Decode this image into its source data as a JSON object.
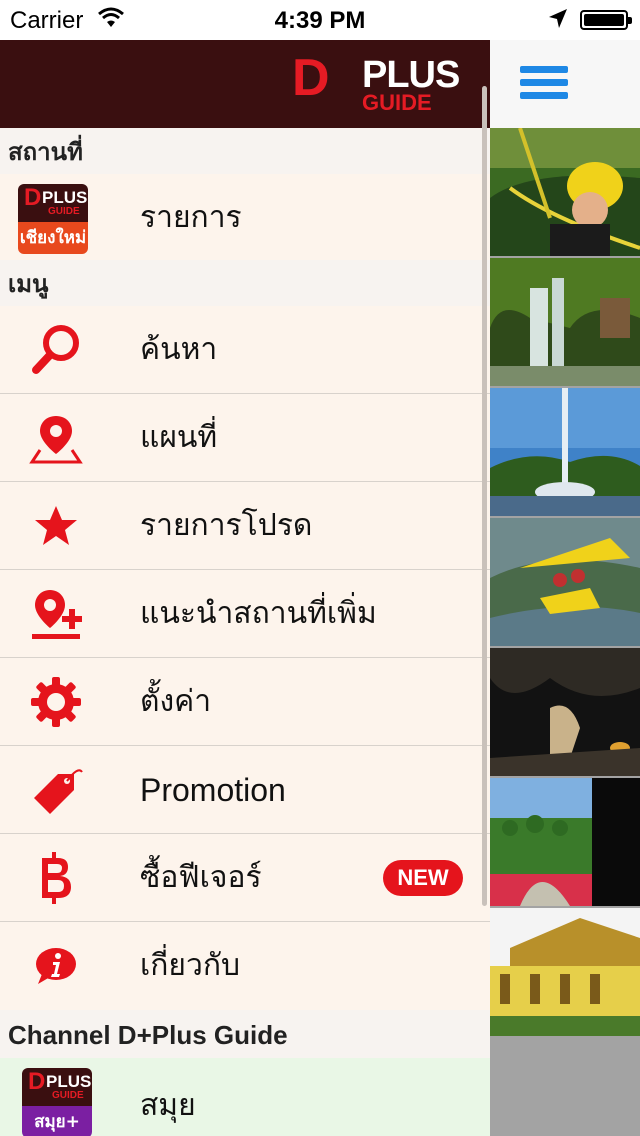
{
  "status_bar": {
    "carrier": "Carrier",
    "time": "4:39 PM"
  },
  "brand": {
    "logo_d": "D",
    "logo_plus": "PLUS",
    "logo_guide": "GUIDE",
    "accent": "#e51b24",
    "header_bg": "#3a0f10"
  },
  "sections": {
    "places_label": "สถานที่",
    "menu_label": "เมนู",
    "channel_label": "Channel D+Plus Guide"
  },
  "places": {
    "item_label": "รายการ",
    "thumb_text": "เชียงใหม่"
  },
  "menu_items": [
    {
      "label": "ค้นหา",
      "icon": "search-icon"
    },
    {
      "label": "แผนที่",
      "icon": "map-pin-icon"
    },
    {
      "label": "รายการโปรด",
      "icon": "star-icon"
    },
    {
      "label": "แนะนำสถานที่เพิ่ม",
      "icon": "add-location-icon"
    },
    {
      "label": "ตั้งค่า",
      "icon": "gear-icon"
    },
    {
      "label": "Promotion",
      "icon": "tag-icon"
    },
    {
      "label": "ซื้อฟีเจอร์",
      "icon": "baht-icon",
      "badge": "NEW"
    },
    {
      "label": "เกี่ยวกับ",
      "icon": "info-icon"
    }
  ],
  "channel": {
    "item_label": "สมุย",
    "thumb_text": "สมุย+"
  }
}
